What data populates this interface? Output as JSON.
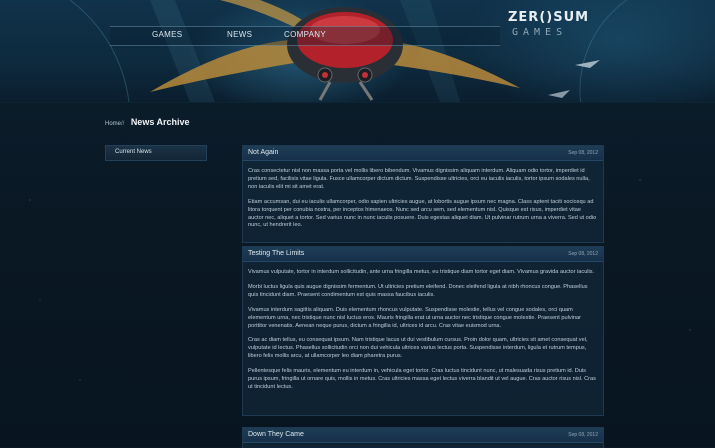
{
  "nav": {
    "items": [
      "GAMES",
      "NEWS",
      "COMPANY"
    ]
  },
  "logo": {
    "main": "ZER()SUM",
    "sub": "GAMES"
  },
  "breadcrumb": {
    "home": "Home",
    "separator": "//",
    "current": "News Archive"
  },
  "sidebar": {
    "items": [
      "Current News"
    ]
  },
  "posts": [
    {
      "title": "Not Again",
      "date": "Sep 08, 2012",
      "paragraphs": [
        "Cras consectetur nisl non massa porta vel mollis libero bibendum. Vivamus dignissim aliquam interdum. Aliquam odio tortor, imperdiet id pretium sed, facilisis vitae ligula. Fusce ullamcorper dictum dictum. Suspendisse ultricies, orci eu iaculis iaculis, tortor ipsum sodales nulla, non iaculis elit mi sit amet erat.",
        "Etiam accumsan, dui eu iaculis ullamcorper, odio sapien ultricies augue, at lobortis augue ipsum nec magna. Class aptent taciti sociosqu ad litora torquent per conubia nostra, per inceptos himenaeos. Nunc sed arcu sem, sed elementum nisl. Quisque est risus, imperdiet vitae auctor nec, aliquet a tortor. Sed varius nunc in nunc iaculis posuere. Duis egestas aliquet diam. Ut pulvinar rutrum urna a viverra. Sed ut odio nunc, ut hendrerit leo."
      ]
    },
    {
      "title": "Testing The Limits",
      "date": "Sep 08, 2012",
      "paragraphs": [
        "Vivamus vulputate, tortor in interdum sollicitudin, ante urna fringilla metus, eu tristique diam tortor eget diam. Vivamus gravida auctor iaculis.",
        "Morbi luctus ligula quis augue dignissim fermentum. Ut ultricies pretium eleifend. Donec eleifend ligula at nibh rhoncus congue. Phasellus quis tincidunt diam. Praesent condimentum est quis massa faucibus iaculis.",
        "Vivamus interdum sagittis aliquam. Duis elementum rhoncus vulputate. Suspendisse molestie, tellus vel congue sodales, orci quam elementum urna, nec tristique nunc nisl luctus eros. Mauris fringilla erat ut urna auctor nec tristique congue molestie. Praesent pulvinar porttitor venenatis. Aenean neque purus, dictum a fringilla id, ultrices id arcu. Cras vitae euismod urna.",
        "Cras ac diam tellus, eu consequat ipsum. Nam tristique lacus ut dui vestibulum cursus. Proin dolor quam, ultricies sit amet consequat vel, vulputate id lectus. Phasellus sollicitudin orci non dui vehicula ultrices varius lectus porta. Suspendisse interdum, ligula et rutrum tempus, libero felis mollis arcu, at ullamcorper leo diam pharetra purus.",
        "Pellentesque felis mauris, elementum eu interdum in, vehicula eget tortor. Cras luctus tincidunt nunc, ut malesuada risus pretium id. Duis purus ipsum, fringilla ut ornare quis, mollis in metus. Cras ultricies massa eget lectus viverra blandit ut vel augue. Cras auctor risus nisl. Cras ut tincidunt lectus."
      ]
    },
    {
      "title": "Down They Came",
      "date": "Sep 08, 2012",
      "paragraphs": []
    }
  ],
  "colors": {
    "background": "#0a1a27",
    "panel": "#14304a",
    "text": "#bfd0dc",
    "title": "#dfe9f0"
  }
}
